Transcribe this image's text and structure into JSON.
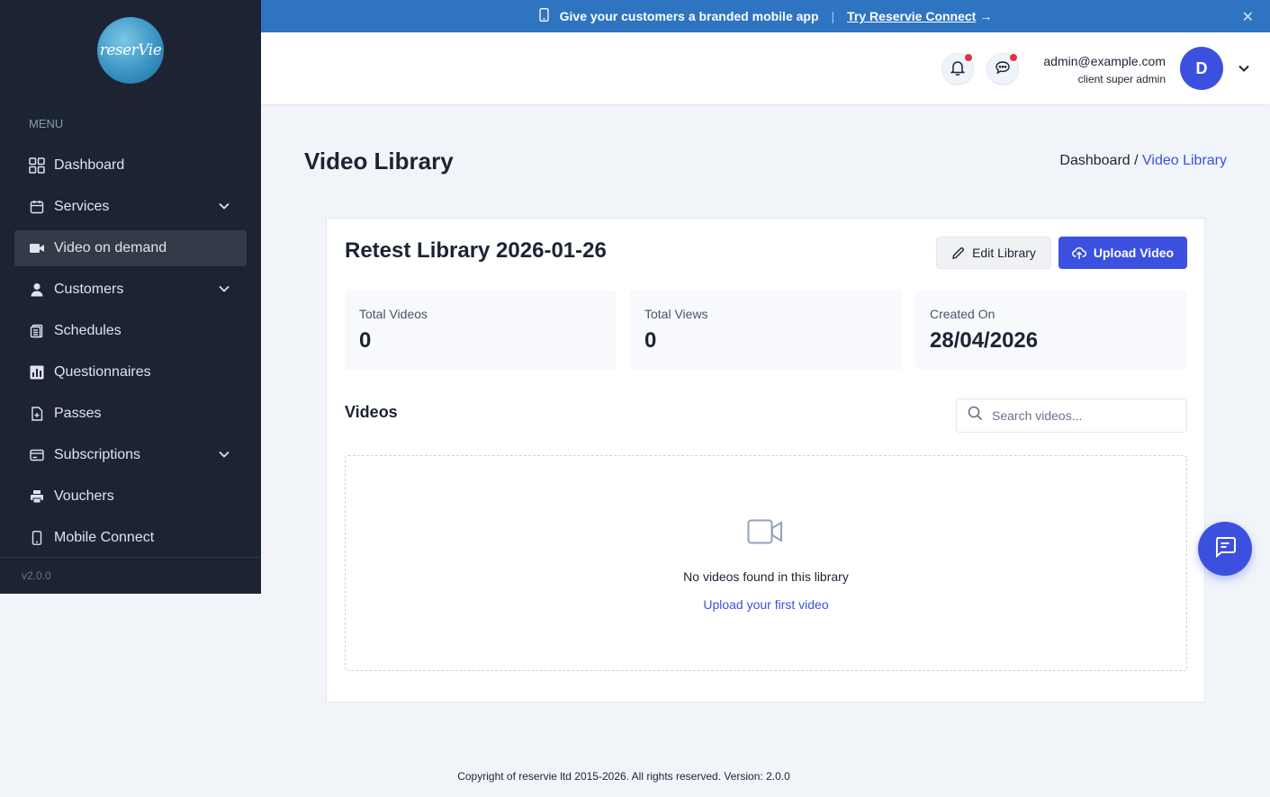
{
  "sidebar": {
    "logo_text": "reserVie",
    "menu_heading": "MENU",
    "items": [
      {
        "label": "Dashboard",
        "icon": "grid-icon"
      },
      {
        "label": "Services",
        "icon": "calendar-icon"
      },
      {
        "label": "Video on demand",
        "icon": "video-camera-icon"
      },
      {
        "label": "Customers",
        "icon": "user-icon"
      },
      {
        "label": "Schedules",
        "icon": "clipboard-icon"
      },
      {
        "label": "Questionnaires",
        "icon": "bar-chart-icon"
      },
      {
        "label": "Passes",
        "icon": "document-icon"
      },
      {
        "label": "Subscriptions",
        "icon": "card-icon"
      },
      {
        "label": "Vouchers",
        "icon": "printer-icon"
      },
      {
        "label": "Mobile Connect",
        "icon": "mobile-icon"
      }
    ],
    "version": "v2.0.0"
  },
  "banner": {
    "message": "Give your customers a branded mobile app",
    "separator": "|",
    "link_label": "Try Reservie Connect",
    "arrow": "→",
    "close": "✕"
  },
  "header": {
    "user_email": "admin@example.com",
    "user_role": "client super admin",
    "avatar_initial": "D"
  },
  "page": {
    "title": "Video Library",
    "breadcrumb_home": "Dashboard /",
    "breadcrumb_current": "Video Library"
  },
  "library": {
    "title": "Retest Library 2026-01-26",
    "edit_label": "Edit Library",
    "upload_label": "Upload Video",
    "stats": [
      {
        "label": "Total Videos",
        "value": "0"
      },
      {
        "label": "Total Views",
        "value": "0"
      },
      {
        "label": "Created On",
        "value": "28/04/2026"
      }
    ],
    "videos_heading": "Videos",
    "search_placeholder": "Search videos...",
    "empty_text": "No videos found in this library",
    "empty_link": "Upload your first video"
  },
  "footer": {
    "text": "Copyright of reservie ltd 2015-2026. All rights reserved. Version: 2.0.0"
  },
  "colors": {
    "sidebar_bg": "#1c2434",
    "banner_bg": "#2e74c0",
    "primary": "#3c50e0",
    "notification_dot": "#dc3545"
  }
}
